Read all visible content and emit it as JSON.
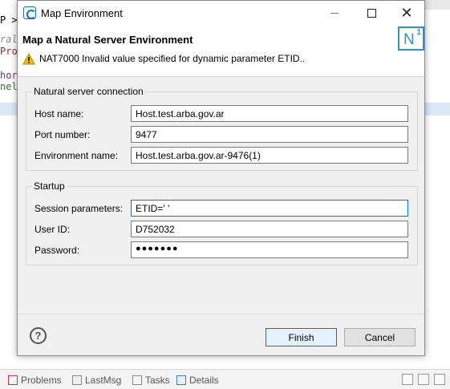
{
  "background": {
    "editor_lines": [
      "P >",
      "ral",
      "Pro",
      "hor",
      "nell"
    ],
    "bottom_tabs": [
      {
        "label": "Problems",
        "icon": "problems-icon"
      },
      {
        "label": "LastMsg",
        "icon": "lastmsg-icon"
      },
      {
        "label": "Tasks",
        "icon": "tasks-icon"
      },
      {
        "label": "Details",
        "icon": "details-icon"
      }
    ]
  },
  "dialog": {
    "title": "Map Environment",
    "header_title": "Map a Natural Server Environment",
    "message": "NAT7000 Invalid value specified for dynamic parameter ETID..",
    "logo_letter": "N",
    "logo_sup": "1",
    "connection": {
      "group_label": "Natural server connection",
      "host_label": "Host name:",
      "host_value": "Host.test.arba.gov.ar",
      "port_label": "Port number:",
      "port_value": "9477",
      "env_label": "Environment name:",
      "env_value": "Host.test.arba.gov.ar-9476(1)"
    },
    "startup": {
      "group_label": "Startup",
      "session_label": "Session parameters:",
      "session_value": "ETID=' '",
      "userid_label": "User ID:",
      "userid_value": "D752032",
      "password_label": "Password:",
      "password_value": "●●●●●●●"
    },
    "help_glyph": "?",
    "finish_label": "Finish",
    "cancel_label": "Cancel"
  },
  "colors": {
    "accent": "#0078d7",
    "logo_blue": "#3a8fc0",
    "warning": "#f2c200"
  }
}
